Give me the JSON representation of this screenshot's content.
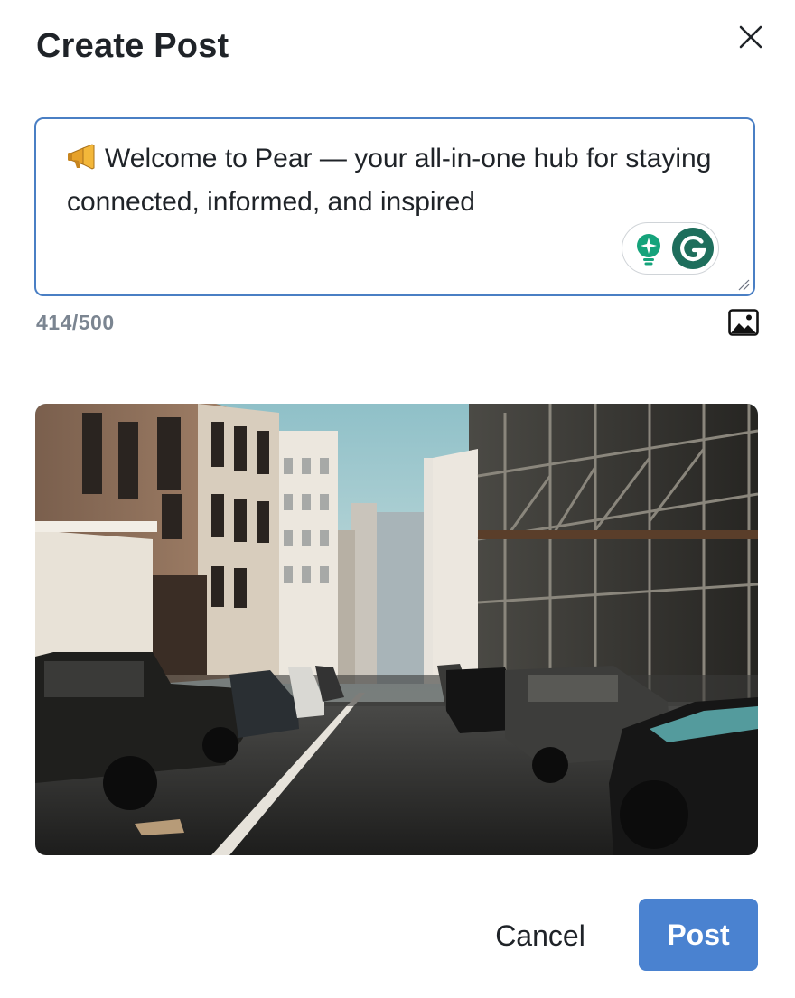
{
  "dialog": {
    "title": "Create Post",
    "close_icon": "close-icon"
  },
  "editor": {
    "emoji_icon": "megaphone-icon",
    "text": "Welcome to Pear — your all-in-one hub for staying connected, informed, and inspired",
    "grammarly": {
      "suggestion_icon": "lightbulb-icon",
      "logo_icon": "grammarly-logo-icon",
      "accent_color": "#15a37b",
      "dark_color": "#1e6e5c"
    }
  },
  "meta": {
    "char_count": "414/500",
    "image_icon": "image-icon"
  },
  "attachment": {
    "type": "photo",
    "subject": "city-street-photo"
  },
  "actions": {
    "cancel_label": "Cancel",
    "post_label": "Post",
    "primary_color": "#4a82d0"
  }
}
